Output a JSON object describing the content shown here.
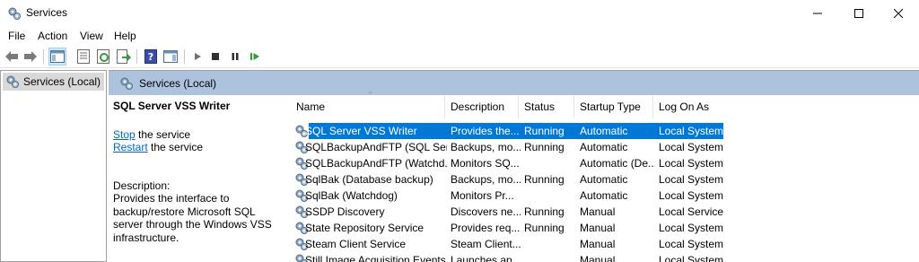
{
  "window": {
    "title": "Services",
    "icon": "services-gear-icon"
  },
  "menu": [
    "File",
    "Action",
    "View",
    "Help"
  ],
  "toolbar": {
    "buttons": [
      "back-arrow-icon",
      "forward-arrow-icon",
      "console-tree-icon",
      "properties-icon",
      "refresh-icon",
      "export-list-icon",
      "help-icon",
      "show-hide-action-pane-icon",
      "start-service-icon",
      "stop-service-icon",
      "pause-service-icon",
      "restart-service-icon"
    ]
  },
  "tree": {
    "item": "Services (Local)"
  },
  "pane": {
    "header": "Services (Local)"
  },
  "details": {
    "title": "SQL Server VSS Writer",
    "stop_link": "Stop",
    "stop_rest": " the service",
    "restart_link": "Restart",
    "restart_rest": " the service",
    "description_label": "Description:",
    "description": "Provides the interface to backup/restore Microsoft SQL server through the Windows VSS infrastructure."
  },
  "columns": [
    "Name",
    "Description",
    "Status",
    "Startup Type",
    "Log On As"
  ],
  "rows": [
    {
      "name": "SQL Server VSS Writer",
      "description": "Provides the...",
      "status": "Running",
      "startup": "Automatic",
      "logon": "Local System",
      "selected": true
    },
    {
      "name": "SQLBackupAndFTP (SQL Serv...",
      "description": "Backups, mo...",
      "status": "Running",
      "startup": "Automatic",
      "logon": "Local System"
    },
    {
      "name": "SQLBackupAndFTP (Watchd...",
      "description": "Monitors SQ...",
      "status": "",
      "startup": "Automatic (De...",
      "logon": "Local System"
    },
    {
      "name": "SqlBak (Database backup)",
      "description": "Backups, mo...",
      "status": "Running",
      "startup": "Automatic",
      "logon": "Local System"
    },
    {
      "name": "SqlBak (Watchdog)",
      "description": "Monitors Pr...",
      "status": "",
      "startup": "Automatic",
      "logon": "Local System"
    },
    {
      "name": "SSDP Discovery",
      "description": "Discovers ne...",
      "status": "Running",
      "startup": "Manual",
      "logon": "Local Service"
    },
    {
      "name": "State Repository Service",
      "description": "Provides req...",
      "status": "Running",
      "startup": "Manual",
      "logon": "Local System"
    },
    {
      "name": "Steam Client Service",
      "description": "Steam Client...",
      "status": "",
      "startup": "Manual",
      "logon": "Local System"
    },
    {
      "name": "Still Image Acquisition Events",
      "description": "Launches ap...",
      "status": "",
      "startup": "Manual",
      "logon": "Local System"
    }
  ],
  "colors": {
    "selection": "#0078d7",
    "pane_header": "#adc3dd",
    "link": "#0066cc"
  }
}
